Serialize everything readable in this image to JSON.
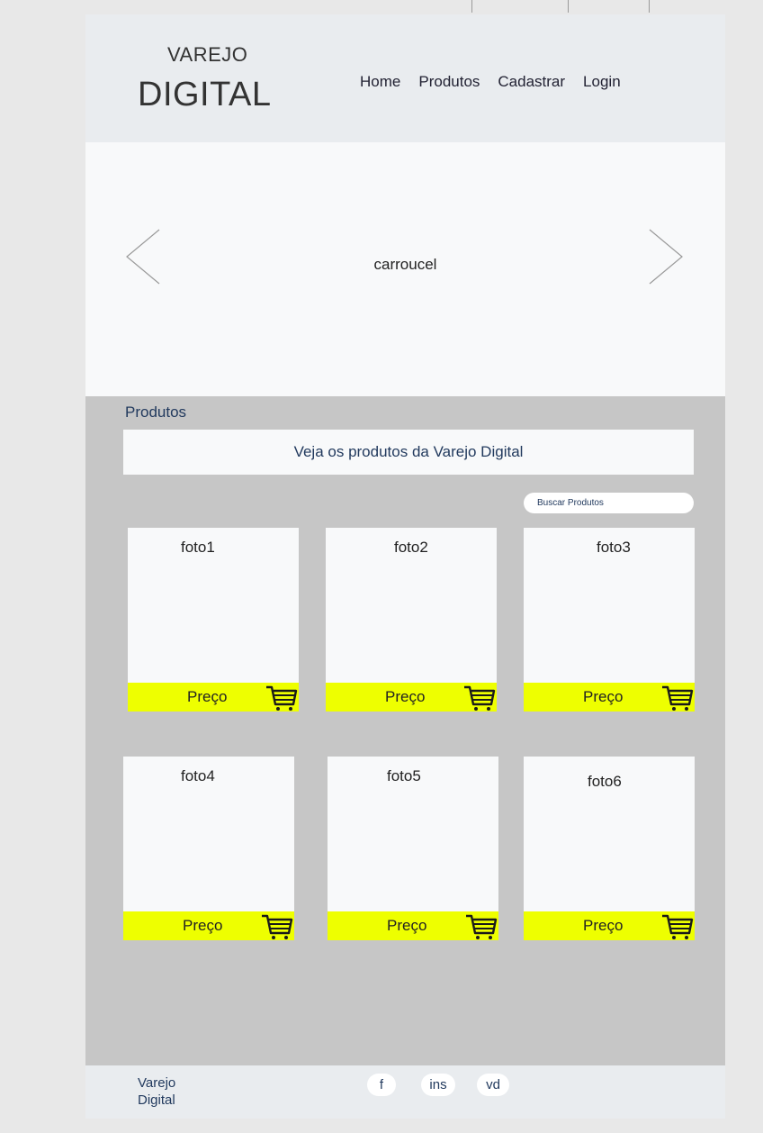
{
  "header": {
    "logo_line1": "VAREJO",
    "logo_line2": "DIGITAL",
    "nav": [
      "Home",
      "Produtos",
      "Cadastrar",
      "Login"
    ]
  },
  "carousel": {
    "label": "carroucel",
    "prev_icon": "chevron-left-icon",
    "next_icon": "chevron-right-icon"
  },
  "products_section": {
    "title": "Produtos",
    "banner": "Veja os produtos da Varejo Digital",
    "search_label": "Buscar Produtos",
    "price_label": "Preço",
    "cart_icon": "cart-icon",
    "cards": [
      {
        "title": "foto1"
      },
      {
        "title": "foto2"
      },
      {
        "title": "foto3"
      },
      {
        "title": "foto4"
      },
      {
        "title": "foto5"
      },
      {
        "title": "foto6"
      }
    ]
  },
  "footer": {
    "brand_line1": "Varejo",
    "brand_line2": "Digital",
    "social": [
      "f",
      "ins",
      "vd"
    ]
  },
  "colors": {
    "header_bg": "#e9ecef",
    "carousel_bg": "#f8f9fa",
    "section_bg": "#c6c6c6",
    "price_bar": "#eeff00",
    "text_accent": "#223a5e"
  }
}
